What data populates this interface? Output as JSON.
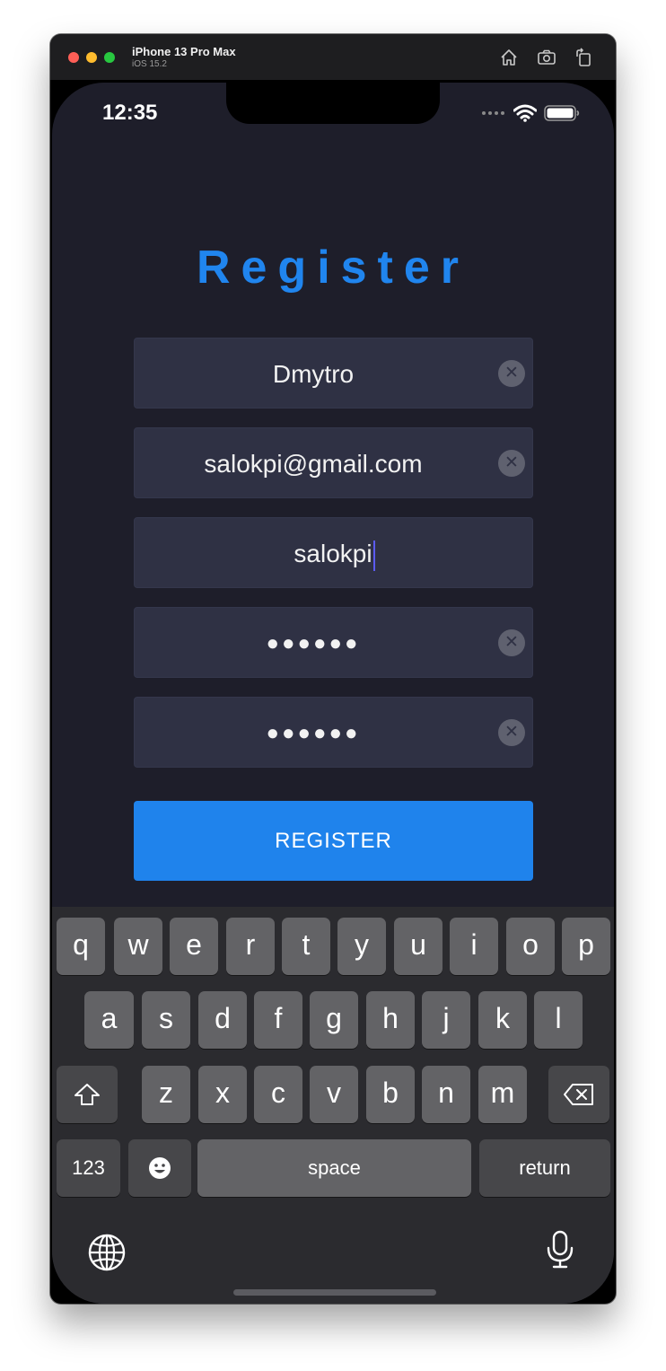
{
  "window": {
    "device_name": "iPhone 13 Pro Max",
    "os_version": "iOS 15.2",
    "toolbar_icons": [
      "home-icon",
      "screenshot-icon",
      "rotate-icon"
    ]
  },
  "status_bar": {
    "time": "12:35",
    "icons": [
      "cellular-signal-icon",
      "wifi-icon",
      "battery-icon"
    ]
  },
  "form": {
    "title": "Register",
    "fields": [
      {
        "name": "name",
        "value": "Dmytro"
      },
      {
        "name": "email",
        "value": "salokpi@gmail.com"
      },
      {
        "name": "username",
        "value": "salokpi"
      },
      {
        "name": "password",
        "value": "●●●●●●"
      },
      {
        "name": "confirm-password",
        "value": "●●●●●●"
      }
    ],
    "submit_label": "REGISTER"
  },
  "keyboard": {
    "row1": [
      "q",
      "w",
      "e",
      "r",
      "t",
      "y",
      "u",
      "i",
      "o",
      "p"
    ],
    "row2": [
      "a",
      "s",
      "d",
      "f",
      "g",
      "h",
      "j",
      "k",
      "l"
    ],
    "row3": [
      "z",
      "x",
      "c",
      "v",
      "b",
      "n",
      "m"
    ],
    "numbers_label": "123",
    "space_label": "space",
    "return_label": "return"
  },
  "colors": {
    "accent": "#1f83ec",
    "background": "#1e1e2a",
    "field_background": "#2f3144",
    "cursor": "#5b5bf4"
  }
}
